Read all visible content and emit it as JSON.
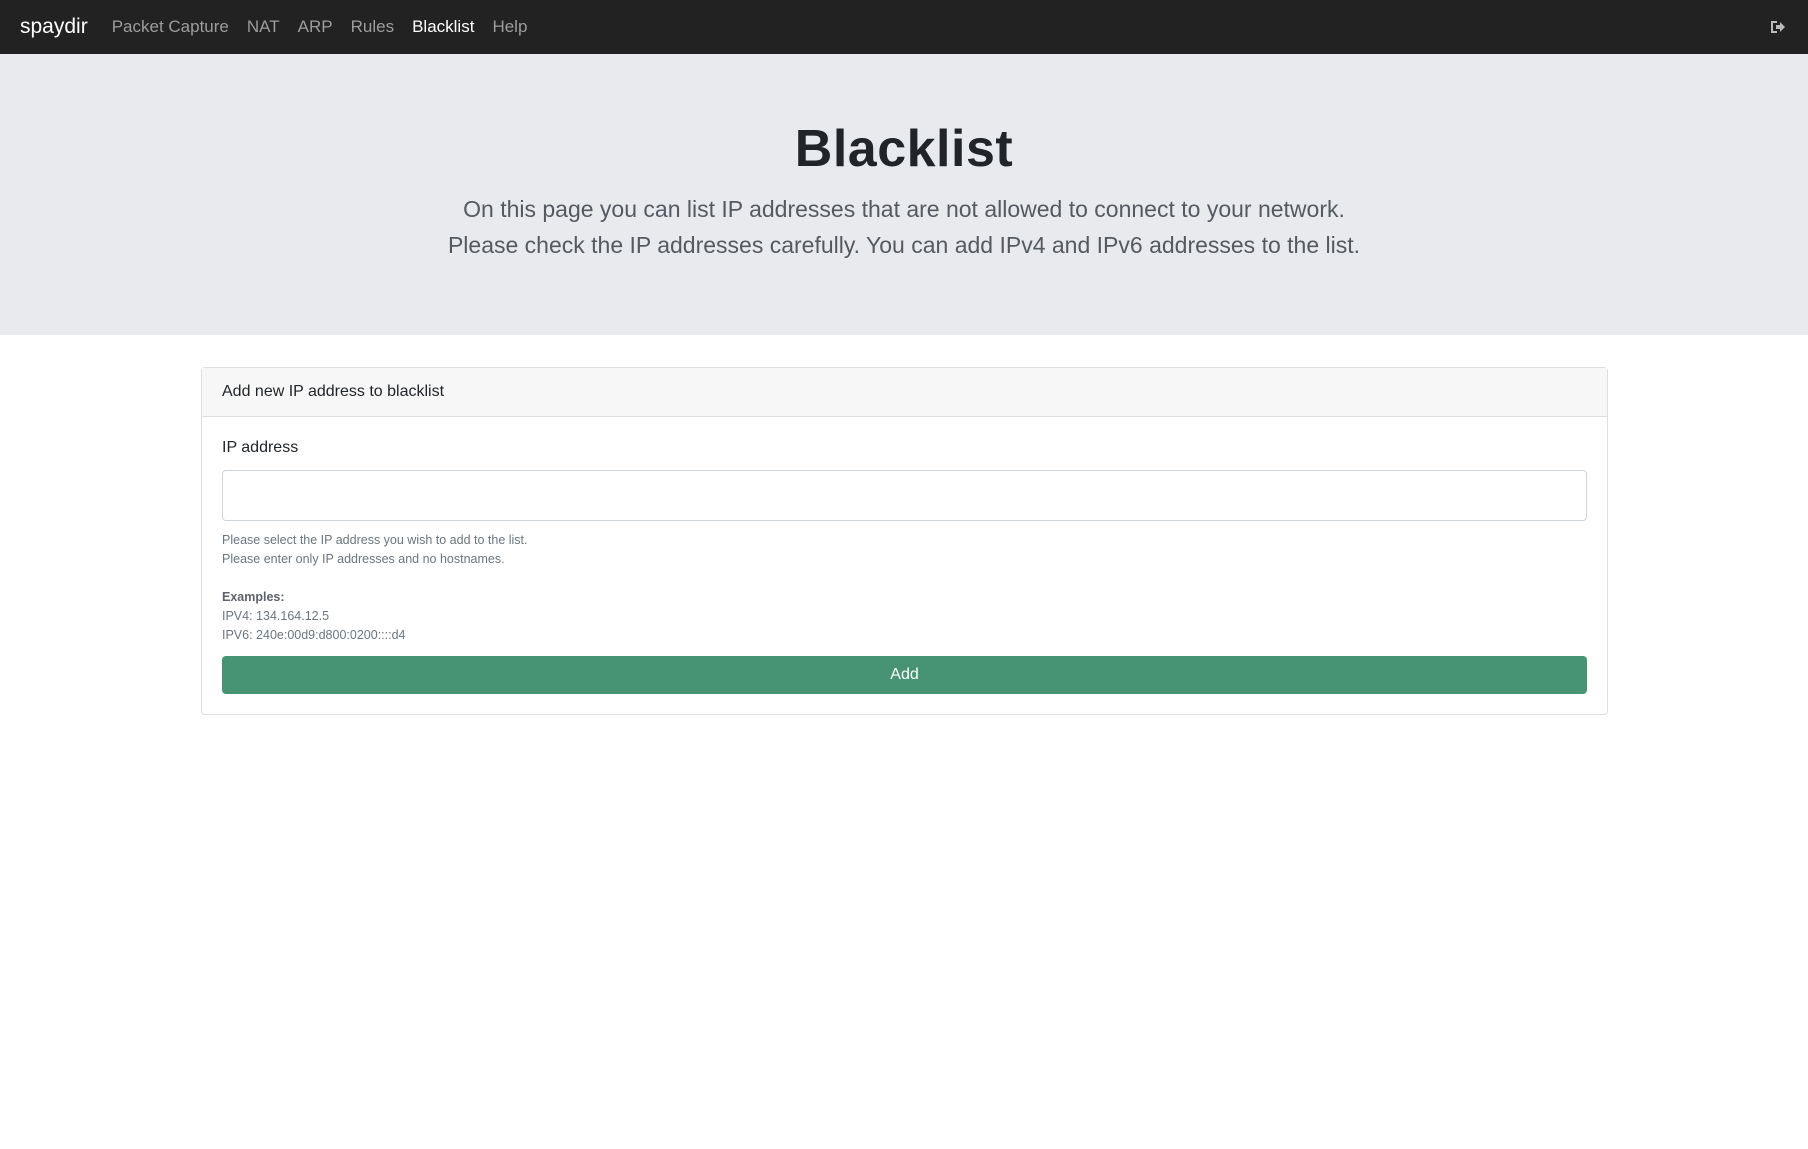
{
  "navbar": {
    "brand": "spaydir",
    "links": [
      {
        "label": "Packet Capture"
      },
      {
        "label": "NAT"
      },
      {
        "label": "ARP"
      },
      {
        "label": "Rules"
      },
      {
        "label": "Blacklist",
        "active": true
      },
      {
        "label": "Help"
      }
    ],
    "logout_icon": "sign-out-icon"
  },
  "hero": {
    "title": "Blacklist",
    "line1": "On this page you can list IP addresses that are not allowed to connect to your network.",
    "line2": "Please check the IP addresses carefully. You can add IPv4 and IPv6 addresses to the list."
  },
  "form": {
    "header": "Add new IP address to blacklist",
    "ip_label": "IP address",
    "ip_value": "",
    "help1": "Please select the IP address you wish to add to the list.",
    "help2": "Please enter only IP addresses and no hostnames.",
    "examples_title": "Examples:",
    "example_ipv4": "IPV4: 134.164.12.5",
    "example_ipv6": "IPV6: 240e:00d9:d800:0200::::d4",
    "add_button": "Add"
  },
  "colors": {
    "navbar_bg": "#222222",
    "hero_bg": "#e9eaee",
    "add_button_bg": "#469473"
  }
}
